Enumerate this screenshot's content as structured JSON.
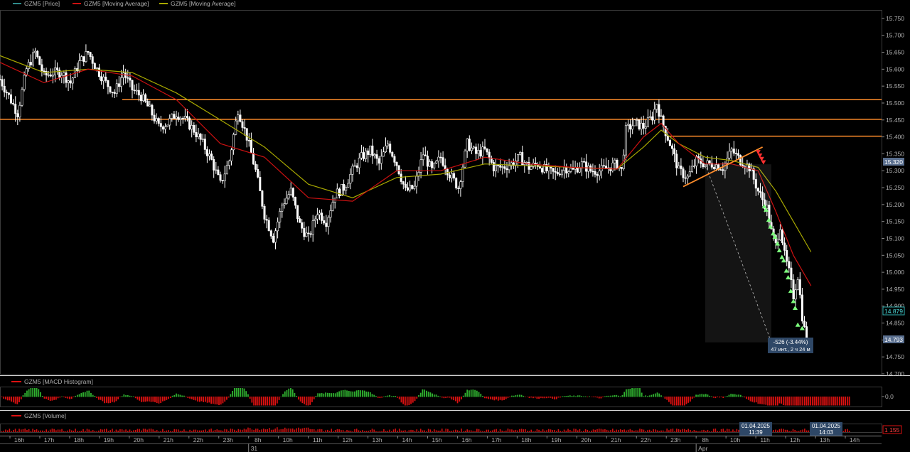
{
  "legend": {
    "price": "GZM5 [Price]",
    "ma1": "GZM5 [Moving Average]",
    "ma2": "GZM5 [Moving Average]"
  },
  "macd_panel": {
    "label": "GZM5 [MACD Histogram]",
    "axis_value": "0,0"
  },
  "volume_panel": {
    "label": "GZM5 [Volume]",
    "last_value": "1 155"
  },
  "colors": {
    "background": "#000000",
    "candle": "#ffffff",
    "ma_fast": "#cc1111",
    "ma_slow": "#a8a800",
    "levels": "#ff8c2a",
    "macd_up": "#2fb02f",
    "macd_down": "#dd1111",
    "volume": "#cc1111",
    "signal_up": "#7dff7d",
    "signal_down": "#ff3030"
  },
  "price_badges": {
    "current": "15.320",
    "mid": "14.879",
    "low": "14.793"
  },
  "measurement": {
    "change": "-526 (-3.44%)",
    "duration": "47 инт., 2 ч 24 м"
  },
  "crosshair_labels": [
    {
      "date": "01.04.2025",
      "time": "11:39"
    },
    {
      "date": "01.04.2025",
      "time": "14:03"
    }
  ],
  "chart_data": {
    "type": "candlestick",
    "instrument": "GZM5",
    "ylim": [
      14700,
      15775
    ],
    "y_ticks": [
      15750,
      15700,
      15650,
      15600,
      15550,
      15500,
      15450,
      15400,
      15350,
      15300,
      15250,
      15200,
      15150,
      15100,
      15050,
      15000,
      14950,
      14900,
      14850,
      14800,
      14750,
      14700
    ],
    "y_tick_labels": [
      "15.750",
      "15.700",
      "15.650",
      "15.600",
      "15.550",
      "15.500",
      "15.450",
      "15.400",
      "15.350",
      "15.300",
      "15.250",
      "15.200",
      "15.150",
      "15.100",
      "15.050",
      "15.000",
      "14.950",
      "14.900",
      "14.850",
      "14.800",
      "14.750",
      "14.700"
    ],
    "x_labels": [
      "16h",
      "17h",
      "18h",
      "19h",
      "20h",
      "21h",
      "22h",
      "23h",
      "8h",
      "10h",
      "11h",
      "12h",
      "13h",
      "14h",
      "15h",
      "16h",
      "17h",
      "18h",
      "19h",
      "20h",
      "21h",
      "22h",
      "23h",
      "8h",
      "10h",
      "11h",
      "12h",
      "13h",
      "14h"
    ],
    "day_labels": [
      {
        "label": "31",
        "at": 8
      },
      {
        "label": "Apr",
        "at": 23
      }
    ],
    "horizontal_levels": [
      15510,
      15452,
      15402
    ],
    "trendline": {
      "from": [
        0.775,
        15253
      ],
      "to": [
        0.865,
        15370
      ]
    },
    "measure": {
      "from": [
        0.8,
        15319
      ],
      "to": [
        0.875,
        14793
      ]
    },
    "price_path": [
      [
        0,
        15570
      ],
      [
        0.01,
        15520
      ],
      [
        0.02,
        15470
      ],
      [
        0.03,
        15600
      ],
      [
        0.04,
        15650
      ],
      [
        0.05,
        15580
      ],
      [
        0.06,
        15590
      ],
      [
        0.07,
        15590
      ],
      [
        0.08,
        15560
      ],
      [
        0.09,
        15620
      ],
      [
        0.1,
        15650
      ],
      [
        0.11,
        15600
      ],
      [
        0.12,
        15560
      ],
      [
        0.13,
        15530
      ],
      [
        0.14,
        15590
      ],
      [
        0.15,
        15540
      ],
      [
        0.16,
        15520
      ],
      [
        0.17,
        15480
      ],
      [
        0.18,
        15430
      ],
      [
        0.19,
        15440
      ],
      [
        0.2,
        15470
      ],
      [
        0.21,
        15450
      ],
      [
        0.22,
        15420
      ],
      [
        0.23,
        15380
      ],
      [
        0.24,
        15330
      ],
      [
        0.25,
        15260
      ],
      [
        0.26,
        15330
      ],
      [
        0.27,
        15480
      ],
      [
        0.28,
        15400
      ],
      [
        0.29,
        15300
      ],
      [
        0.3,
        15170
      ],
      [
        0.31,
        15100
      ],
      [
        0.32,
        15200
      ],
      [
        0.33,
        15240
      ],
      [
        0.34,
        15140
      ],
      [
        0.35,
        15100
      ],
      [
        0.36,
        15180
      ],
      [
        0.37,
        15150
      ],
      [
        0.38,
        15230
      ],
      [
        0.39,
        15250
      ],
      [
        0.4,
        15300
      ],
      [
        0.41,
        15340
      ],
      [
        0.42,
        15360
      ],
      [
        0.43,
        15320
      ],
      [
        0.44,
        15380
      ],
      [
        0.45,
        15320
      ],
      [
        0.46,
        15240
      ],
      [
        0.47,
        15250
      ],
      [
        0.48,
        15350
      ],
      [
        0.49,
        15300
      ],
      [
        0.5,
        15340
      ],
      [
        0.51,
        15290
      ],
      [
        0.52,
        15250
      ],
      [
        0.53,
        15380
      ],
      [
        0.54,
        15350
      ],
      [
        0.55,
        15360
      ],
      [
        0.56,
        15310
      ],
      [
        0.57,
        15310
      ],
      [
        0.58,
        15320
      ],
      [
        0.59,
        15340
      ],
      [
        0.6,
        15310
      ],
      [
        0.61,
        15320
      ],
      [
        0.62,
        15300
      ],
      [
        0.63,
        15290
      ],
      [
        0.64,
        15310
      ],
      [
        0.65,
        15300
      ],
      [
        0.66,
        15320
      ],
      [
        0.67,
        15300
      ],
      [
        0.68,
        15300
      ],
      [
        0.69,
        15310
      ],
      [
        0.7,
        15320
      ],
      [
        0.705,
        15300
      ],
      [
        0.71,
        15420
      ],
      [
        0.72,
        15440
      ],
      [
        0.73,
        15430
      ],
      [
        0.74,
        15460
      ],
      [
        0.745,
        15500
      ],
      [
        0.75,
        15450
      ],
      [
        0.76,
        15380
      ],
      [
        0.77,
        15300
      ],
      [
        0.78,
        15280
      ],
      [
        0.79,
        15330
      ],
      [
        0.8,
        15320
      ],
      [
        0.81,
        15320
      ],
      [
        0.82,
        15310
      ],
      [
        0.83,
        15360
      ],
      [
        0.84,
        15330
      ],
      [
        0.85,
        15310
      ],
      [
        0.86,
        15240
      ],
      [
        0.87,
        15190
      ],
      [
        0.875,
        15120
      ],
      [
        0.88,
        15080
      ],
      [
        0.885,
        15140
      ],
      [
        0.89,
        15050
      ],
      [
        0.895,
        15000
      ],
      [
        0.9,
        14930
      ],
      [
        0.905,
        14990
      ],
      [
        0.91,
        14870
      ],
      [
        0.915,
        14793
      ]
    ],
    "ma_fast_path": [
      [
        0,
        15620
      ],
      [
        0.05,
        15560
      ],
      [
        0.1,
        15600
      ],
      [
        0.15,
        15580
      ],
      [
        0.2,
        15510
      ],
      [
        0.25,
        15380
      ],
      [
        0.3,
        15340
      ],
      [
        0.35,
        15220
      ],
      [
        0.4,
        15210
      ],
      [
        0.45,
        15300
      ],
      [
        0.5,
        15300
      ],
      [
        0.55,
        15340
      ],
      [
        0.6,
        15320
      ],
      [
        0.65,
        15310
      ],
      [
        0.7,
        15305
      ],
      [
        0.73,
        15400
      ],
      [
        0.75,
        15440
      ],
      [
        0.77,
        15380
      ],
      [
        0.8,
        15320
      ],
      [
        0.83,
        15320
      ],
      [
        0.86,
        15300
      ],
      [
        0.88,
        15180
      ],
      [
        0.9,
        15050
      ],
      [
        0.92,
        14960
      ]
    ],
    "ma_slow_path": [
      [
        0,
        15640
      ],
      [
        0.05,
        15590
      ],
      [
        0.1,
        15600
      ],
      [
        0.15,
        15590
      ],
      [
        0.2,
        15530
      ],
      [
        0.25,
        15450
      ],
      [
        0.3,
        15370
      ],
      [
        0.35,
        15260
      ],
      [
        0.4,
        15220
      ],
      [
        0.45,
        15280
      ],
      [
        0.5,
        15290
      ],
      [
        0.55,
        15320
      ],
      [
        0.6,
        15315
      ],
      [
        0.65,
        15310
      ],
      [
        0.7,
        15305
      ],
      [
        0.73,
        15370
      ],
      [
        0.75,
        15420
      ],
      [
        0.77,
        15380
      ],
      [
        0.8,
        15340
      ],
      [
        0.83,
        15330
      ],
      [
        0.86,
        15310
      ],
      [
        0.88,
        15240
      ],
      [
        0.9,
        15150
      ],
      [
        0.92,
        15060
      ]
    ],
    "up_signals": [
      [
        0.867,
        15210
      ],
      [
        0.869,
        15200
      ],
      [
        0.872,
        15170
      ],
      [
        0.874,
        15150
      ],
      [
        0.877,
        15130
      ],
      [
        0.879,
        15120
      ],
      [
        0.882,
        15100
      ],
      [
        0.884,
        15080
      ],
      [
        0.887,
        15060
      ],
      [
        0.889,
        15050
      ],
      [
        0.892,
        15020
      ],
      [
        0.894,
        15000
      ],
      [
        0.897,
        14960
      ],
      [
        0.9,
        14930
      ],
      [
        0.902,
        14910
      ],
      [
        0.905,
        14860
      ],
      [
        0.91,
        14850
      ],
      [
        0.917,
        14793
      ]
    ],
    "down_signals": [
      [
        0.86,
        15340
      ],
      [
        0.862,
        15330
      ],
      [
        0.864,
        15320
      ],
      [
        0.866,
        15310
      ]
    ]
  }
}
